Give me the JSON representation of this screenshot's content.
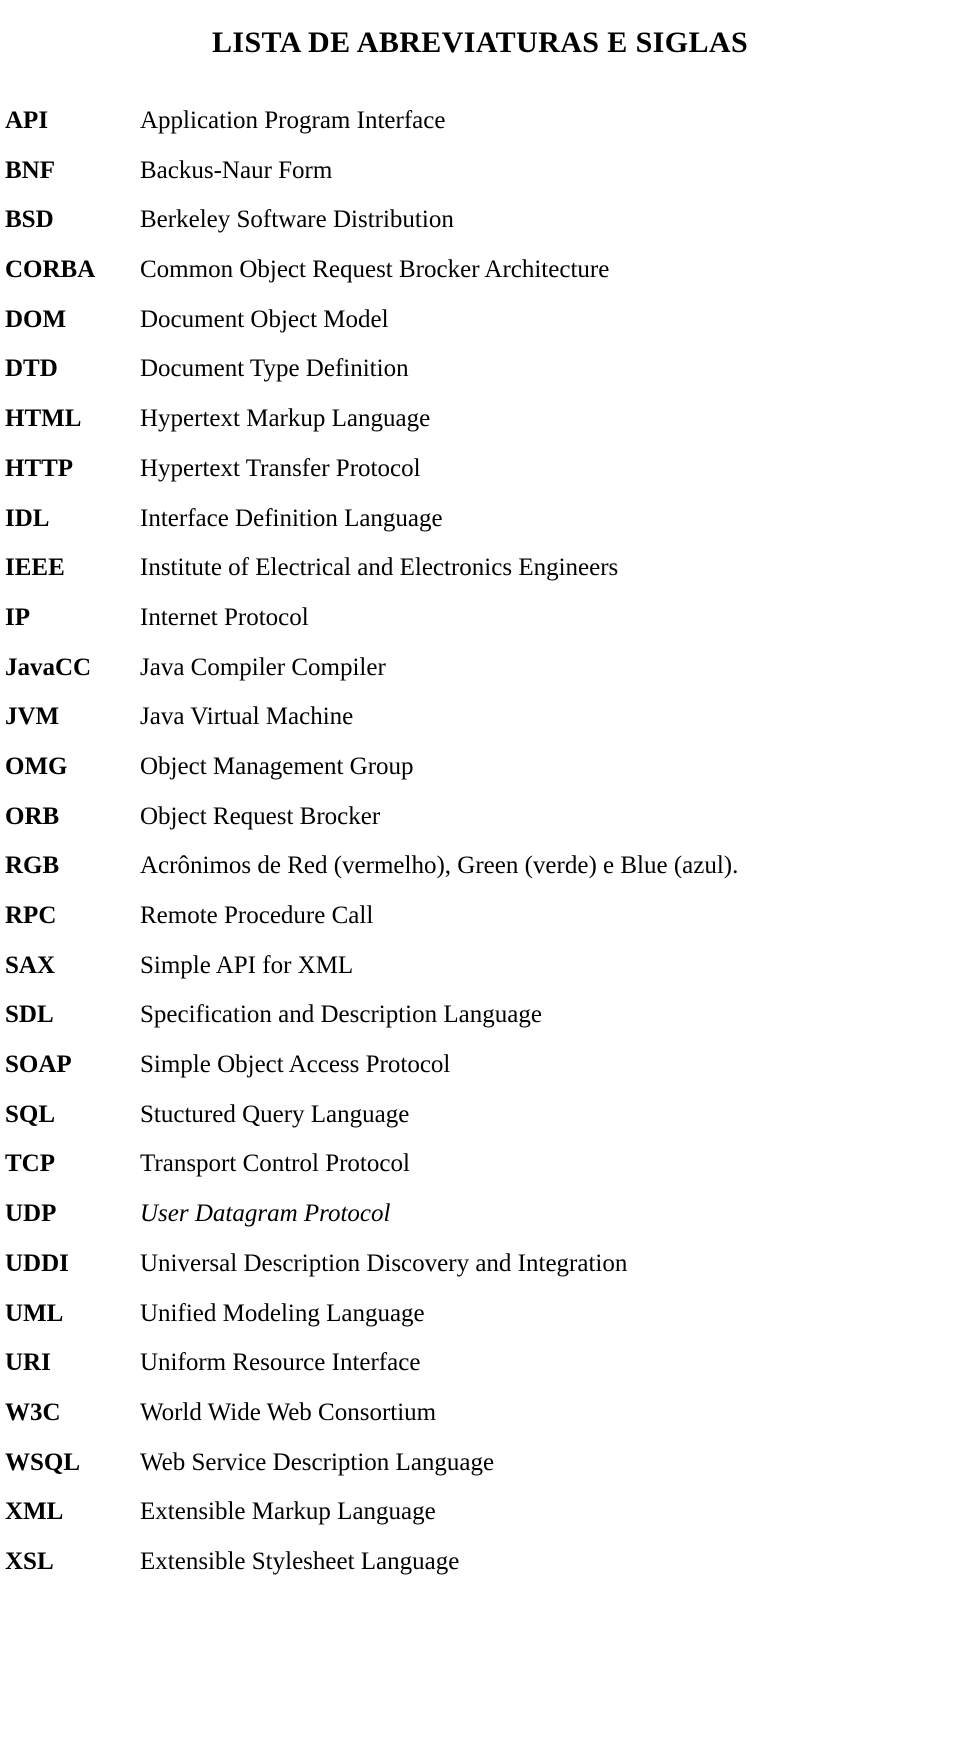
{
  "document": {
    "title": "LISTA DE ABREVIATURAS E SIGLAS",
    "entries": [
      {
        "term": "API",
        "definition": "Application Program Interface",
        "style": "normal"
      },
      {
        "term": "BNF",
        "definition": "Backus-Naur Form",
        "style": "normal"
      },
      {
        "term": "BSD",
        "definition": "Berkeley Software Distribution",
        "style": "normal"
      },
      {
        "term": "CORBA",
        "definition": "Common Object Request Brocker Architecture",
        "style": "normal"
      },
      {
        "term": "DOM",
        "definition": "Document Object Model",
        "style": "normal"
      },
      {
        "term": "DTD",
        "definition": "Document Type Definition",
        "style": "normal"
      },
      {
        "term": "HTML",
        "definition": "Hypertext Markup Language",
        "style": "normal"
      },
      {
        "term": "HTTP",
        "definition": "Hypertext Transfer Protocol",
        "style": "normal"
      },
      {
        "term": "IDL",
        "definition": "Interface Definition Language",
        "style": "normal"
      },
      {
        "term": "IEEE",
        "definition": "Institute of Electrical and Electronics Engineers",
        "style": "normal"
      },
      {
        "term": "IP",
        "definition": "Internet Protocol",
        "style": "normal"
      },
      {
        "term": "JavaCC",
        "definition": "Java Compiler Compiler",
        "style": "normal"
      },
      {
        "term": "JVM",
        "definition": "Java Virtual Machine",
        "style": "normal"
      },
      {
        "term": "OMG",
        "definition": "Object Management Group",
        "style": "normal"
      },
      {
        "term": "ORB",
        "definition": "Object Request Brocker",
        "style": "normal"
      },
      {
        "term": "RGB",
        "definition": "Acrônimos de Red (vermelho), Green (verde) e Blue (azul).",
        "style": "normal"
      },
      {
        "term": "RPC",
        "definition": "Remote Procedure Call",
        "style": "normal"
      },
      {
        "term": "SAX",
        "definition": "Simple API for XML",
        "style": "normal"
      },
      {
        "term": "SDL",
        "definition": "Specification and Description Language",
        "style": "normal"
      },
      {
        "term": "SOAP",
        "definition": "Simple Object Access Protocol",
        "style": "normal"
      },
      {
        "term": "SQL",
        "definition": "Stuctured Query Language",
        "style": "normal"
      },
      {
        "term": "TCP",
        "definition": "Transport Control Protocol",
        "style": "normal"
      },
      {
        "term": "UDP",
        "definition": "User Datagram Protocol",
        "style": "italic"
      },
      {
        "term": "UDDI",
        "definition": "Universal Description Discovery and Integration",
        "style": "normal"
      },
      {
        "term": "UML",
        "definition": "Unified Modeling Language",
        "style": "normal"
      },
      {
        "term": "URI",
        "definition": "Uniform Resource Interface",
        "style": "normal"
      },
      {
        "term": "W3C",
        "definition": "World Wide Web Consortium",
        "style": "normal"
      },
      {
        "term": "WSQL",
        "definition": "Web Service Description Language",
        "style": "normal"
      },
      {
        "term": "XML",
        "definition": "Extensible Markup Language",
        "style": "normal"
      },
      {
        "term": "XSL",
        "definition": "Extensible Stylesheet Language",
        "style": "normal"
      }
    ]
  }
}
